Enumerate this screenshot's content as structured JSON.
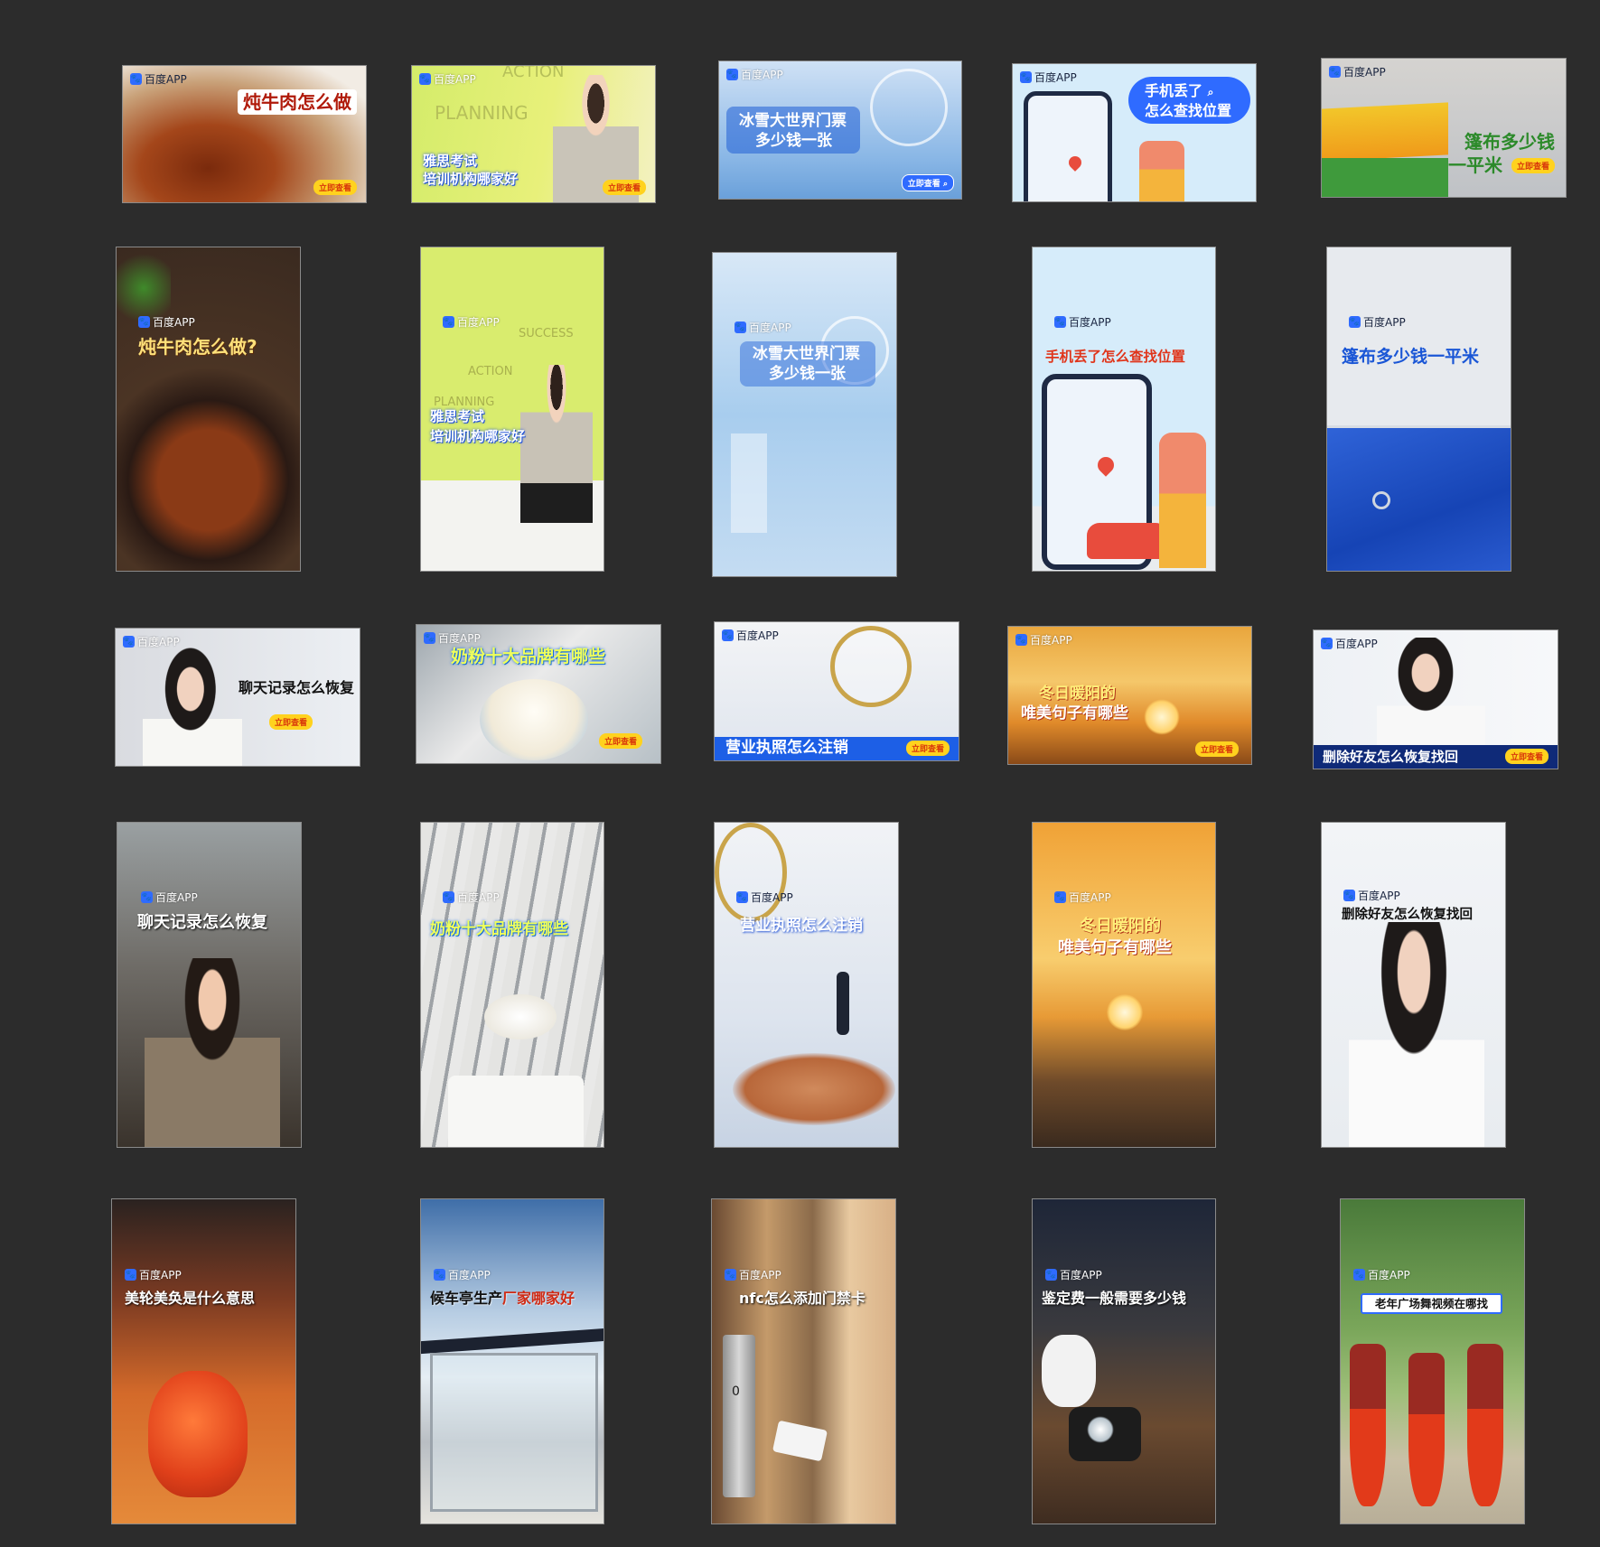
{
  "brand": {
    "logo_text": "百度APP",
    "logo_icon": "baidu-paw-icon",
    "cta_label": "立即查看",
    "accent": "#2f6bff"
  },
  "canvas_bg": "#2c2c2c",
  "ads": [
    {
      "id": "beef-h",
      "headline": "炖牛肉怎么做",
      "has_cta": true
    },
    {
      "id": "ielts-h",
      "headline": "雅思考试培训机构哪家好",
      "line1": "雅思考试",
      "line2": "培训机构哪家好",
      "bg_words": [
        "ACTION",
        "PLANNING"
      ],
      "has_cta": true
    },
    {
      "id": "ice-h",
      "line1": "冰雪大世界门票",
      "line2": "多少钱一张",
      "has_cta": true
    },
    {
      "id": "phone-h",
      "line1": "手机丢了",
      "line2": "怎么查找位置"
    },
    {
      "id": "tarp-h",
      "line1": "篷布多少钱",
      "line2": "一平米",
      "has_cta": true
    },
    {
      "id": "beef-v",
      "headline": "炖牛肉怎么做?"
    },
    {
      "id": "ielts-v",
      "line1": "雅思考试",
      "line2": "培训机构哪家好",
      "bg_words": [
        "SUCCESS",
        "ACTION",
        "PLANNING"
      ]
    },
    {
      "id": "ice-v",
      "line1": "冰雪大世界门票",
      "line2": "多少钱一张"
    },
    {
      "id": "phone-v",
      "headline": "手机丢了怎么查找位置"
    },
    {
      "id": "tarp-v",
      "headline": "篷布多少钱一平米"
    },
    {
      "id": "chat-h",
      "headline": "聊天记录怎么恢复",
      "has_cta": true
    },
    {
      "id": "milk-h",
      "headline": "奶粉十大品牌有哪些",
      "has_cta": true
    },
    {
      "id": "license-h",
      "headline": "营业执照怎么注销",
      "has_cta": true
    },
    {
      "id": "sun-h",
      "line1": "冬日暖阳的",
      "line2": "唯美句子有哪些",
      "has_cta": true
    },
    {
      "id": "friend-h",
      "headline": "删除好友怎么恢复找回",
      "has_cta": true
    },
    {
      "id": "chat-v",
      "headline": "聊天记录怎么恢复"
    },
    {
      "id": "milk-v",
      "headline": "奶粉十大品牌有哪些"
    },
    {
      "id": "license-v",
      "headline": "营业执照怎么注销"
    },
    {
      "id": "sun-v",
      "line1": "冬日暖阳的",
      "line2": "唯美句子有哪些"
    },
    {
      "id": "friend-v",
      "headline": "删除好友怎么恢复找回"
    },
    {
      "id": "idiom-v",
      "headline": "美轮美奂是什么意思"
    },
    {
      "id": "busstop-v",
      "headline": "候车亭生产厂家哪家好",
      "part1": "候车亭生产",
      "part2": "厂家哪家好"
    },
    {
      "id": "nfc-v",
      "headline": "nfc怎么添加门禁卡",
      "lock_digit": "0"
    },
    {
      "id": "appraisal-v",
      "headline": "鉴定费一般需要多少钱"
    },
    {
      "id": "dance-v",
      "headline": "老年广场舞视频在哪找"
    }
  ]
}
